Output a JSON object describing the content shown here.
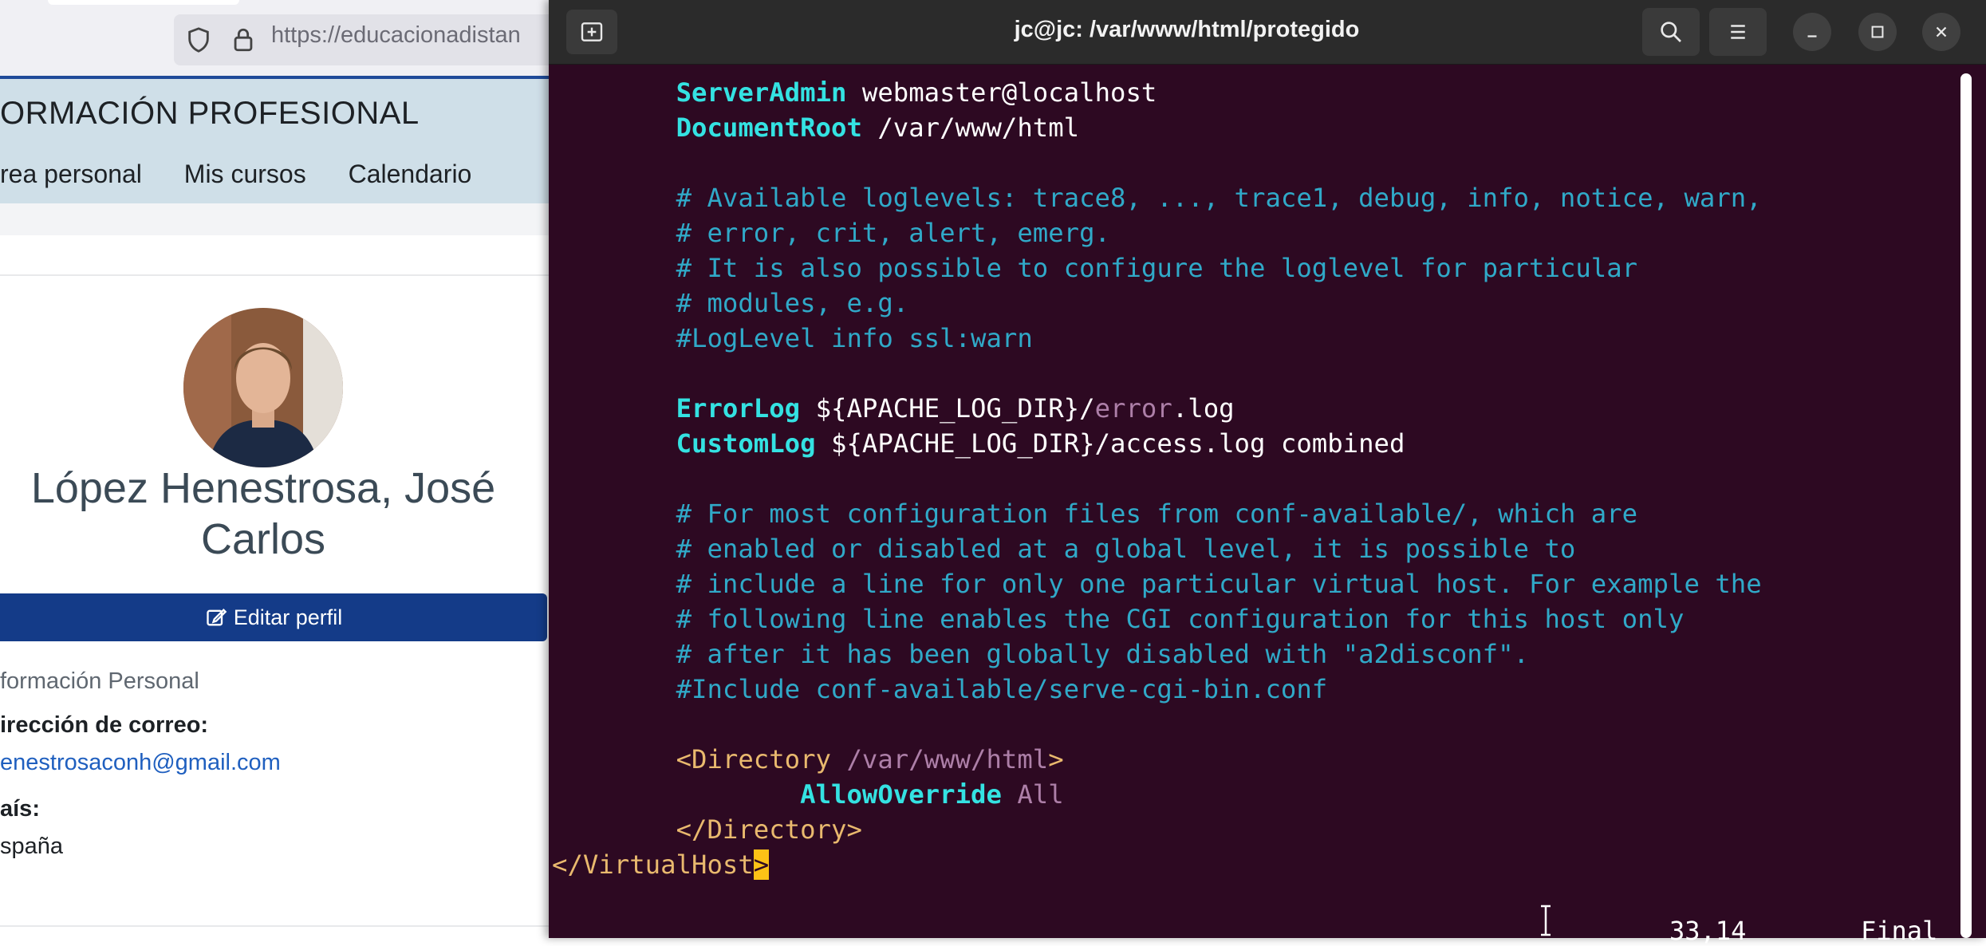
{
  "browser": {
    "url": "https://educacionadistan",
    "site_title": "ORMACIÓN PROFESIONAL",
    "nav": [
      "rea personal",
      "Mis cursos",
      "Calendario"
    ],
    "profile": {
      "name": "López Henestrosa, José Carlos",
      "edit_button": "Editar perfil",
      "section_title": "formación Personal",
      "email_label": "irección de correo:",
      "email": "enestrosaconh@gmail.com",
      "country_label": "aís:",
      "country": "spaña"
    }
  },
  "terminal": {
    "title": "jc@jc: /var/www/html/protegido",
    "status_position": "33,14",
    "status_scroll": "Final",
    "lines": [
      {
        "tokens": [
          {
            "text": "        ",
            "cls": ""
          },
          {
            "text": "ServerAdmin",
            "cls": "k"
          },
          {
            "text": " webmaster@localhost",
            "cls": ""
          }
        ]
      },
      {
        "tokens": [
          {
            "text": "        ",
            "cls": ""
          },
          {
            "text": "DocumentRoot",
            "cls": "k"
          },
          {
            "text": " /var/www/html",
            "cls": ""
          }
        ]
      },
      {
        "tokens": []
      },
      {
        "tokens": [
          {
            "text": "        ",
            "cls": ""
          },
          {
            "text": "# Available loglevels: trace8, ..., trace1, debug, info, notice, warn,",
            "cls": "c"
          }
        ]
      },
      {
        "tokens": [
          {
            "text": "        ",
            "cls": ""
          },
          {
            "text": "# error, crit, alert, emerg.",
            "cls": "c"
          }
        ]
      },
      {
        "tokens": [
          {
            "text": "        ",
            "cls": ""
          },
          {
            "text": "# It is also possible to configure the loglevel for particular",
            "cls": "c"
          }
        ]
      },
      {
        "tokens": [
          {
            "text": "        ",
            "cls": ""
          },
          {
            "text": "# modules, e.g.",
            "cls": "c"
          }
        ]
      },
      {
        "tokens": [
          {
            "text": "        ",
            "cls": ""
          },
          {
            "text": "#LogLevel info ssl:warn",
            "cls": "c"
          }
        ]
      },
      {
        "tokens": []
      },
      {
        "tokens": [
          {
            "text": "        ",
            "cls": ""
          },
          {
            "text": "ErrorLog",
            "cls": "k"
          },
          {
            "text": " ${APACHE_LOG_DIR}/",
            "cls": ""
          },
          {
            "text": "error",
            "cls": "p"
          },
          {
            "text": ".log",
            "cls": ""
          }
        ]
      },
      {
        "tokens": [
          {
            "text": "        ",
            "cls": ""
          },
          {
            "text": "CustomLog",
            "cls": "k"
          },
          {
            "text": " ${APACHE_LOG_DIR}/access.log combined",
            "cls": ""
          }
        ]
      },
      {
        "tokens": []
      },
      {
        "tokens": [
          {
            "text": "        ",
            "cls": ""
          },
          {
            "text": "# For most configuration files from conf-available/, which are",
            "cls": "c"
          }
        ]
      },
      {
        "tokens": [
          {
            "text": "        ",
            "cls": ""
          },
          {
            "text": "# enabled or disabled at a global level, it is possible to",
            "cls": "c"
          }
        ]
      },
      {
        "tokens": [
          {
            "text": "        ",
            "cls": ""
          },
          {
            "text": "# include a line for only one particular virtual host. For example the",
            "cls": "c"
          }
        ]
      },
      {
        "tokens": [
          {
            "text": "        ",
            "cls": ""
          },
          {
            "text": "# following line enables the CGI configuration for this host only",
            "cls": "c"
          }
        ]
      },
      {
        "tokens": [
          {
            "text": "        ",
            "cls": ""
          },
          {
            "text": "# after it has been globally disabled with \"a2disconf\".",
            "cls": "c"
          }
        ]
      },
      {
        "tokens": [
          {
            "text": "        ",
            "cls": ""
          },
          {
            "text": "#Include conf-available/serve-cgi-bin.conf",
            "cls": "c"
          }
        ]
      },
      {
        "tokens": []
      },
      {
        "tokens": [
          {
            "text": "        ",
            "cls": ""
          },
          {
            "text": "<Directory ",
            "cls": "t"
          },
          {
            "text": "/var/www/html",
            "cls": "p"
          },
          {
            "text": ">",
            "cls": "t"
          }
        ]
      },
      {
        "tokens": [
          {
            "text": "                ",
            "cls": ""
          },
          {
            "text": "AllowOverride",
            "cls": "k"
          },
          {
            "text": " ",
            "cls": ""
          },
          {
            "text": "All",
            "cls": "p"
          }
        ]
      },
      {
        "tokens": [
          {
            "text": "        ",
            "cls": ""
          },
          {
            "text": "</Directory>",
            "cls": "t"
          }
        ]
      },
      {
        "tokens": [
          {
            "text": "</VirtualHost",
            "cls": "t"
          },
          {
            "text": ">",
            "cls": "cur"
          }
        ]
      }
    ]
  }
}
